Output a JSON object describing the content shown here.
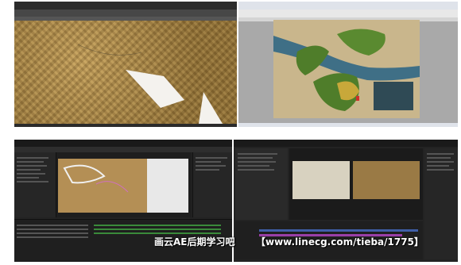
{
  "photoshop": {
    "window": "photoshop-window"
  },
  "illustrator": {
    "legend_title": "",
    "map_labels": []
  },
  "after_effects": {
    "window": "after-effects-window"
  },
  "premiere": {
    "window": "premiere-window"
  },
  "watermark": {
    "left": "画云AE后期学习吧",
    "right": "【www.linecg.com/tieba/1775】"
  },
  "colors": {
    "ps_bg": "#3c3c3c",
    "ai_bg": "#f0f0f0",
    "ae_bg": "#232323",
    "pr_bg": "#232323",
    "map_sea": "#3f6f86",
    "map_green": "#4f7d2a",
    "map_yellow": "#c8a83a",
    "marker_red": "#d0302a"
  }
}
